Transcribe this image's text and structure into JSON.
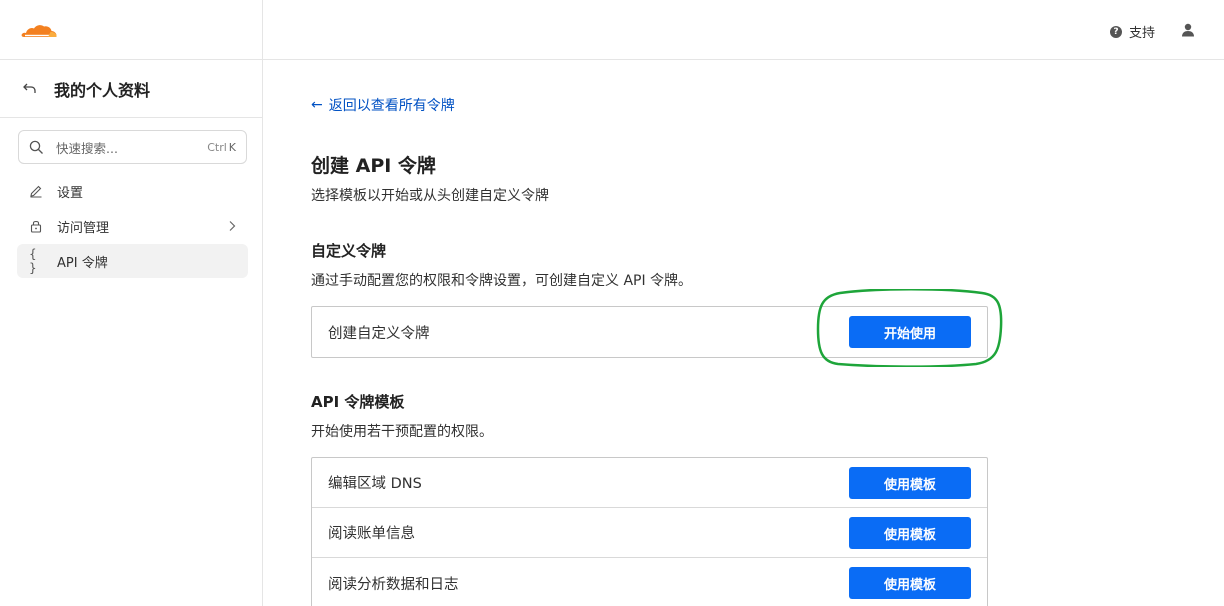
{
  "topbar": {
    "support_label": "支持",
    "help_icon": "question-circle-icon",
    "user_icon": "user-icon",
    "logo_icon": "cloudflare-cloud-logo",
    "accent_color": "#f38020"
  },
  "sidebar": {
    "title": "我的个人资料",
    "search": {
      "placeholder": "快速搜索...",
      "shortcut_ctrl": "Ctrl",
      "shortcut_key": "K"
    },
    "items": [
      {
        "label": "设置",
        "icon": "pencil-icon",
        "active": false
      },
      {
        "label": "访问管理",
        "icon": "lock-icon",
        "active": false,
        "has_submenu": true
      },
      {
        "label": "API 令牌",
        "icon": "braces-icon",
        "active": true
      }
    ]
  },
  "main": {
    "back_link": "返回以查看所有令牌",
    "title": "创建 API 令牌",
    "subtitle": "选择模板以开始或从头创建自定义令牌",
    "custom": {
      "title": "自定义令牌",
      "description": "通过手动配置您的权限和令牌设置，可创建自定义 API 令牌。",
      "row_label": "创建自定义令牌",
      "button": "开始使用"
    },
    "templates": {
      "title": "API 令牌模板",
      "description": "开始使用若干预配置的权限。",
      "rows": [
        {
          "label": "编辑区域 DNS",
          "button": "使用模板"
        },
        {
          "label": "阅读账单信息",
          "button": "使用模板"
        },
        {
          "label": "阅读分析数据和日志",
          "button": "使用模板"
        }
      ]
    },
    "button_color": "#0a6cf5",
    "highlight_color": "#1ea53a"
  }
}
